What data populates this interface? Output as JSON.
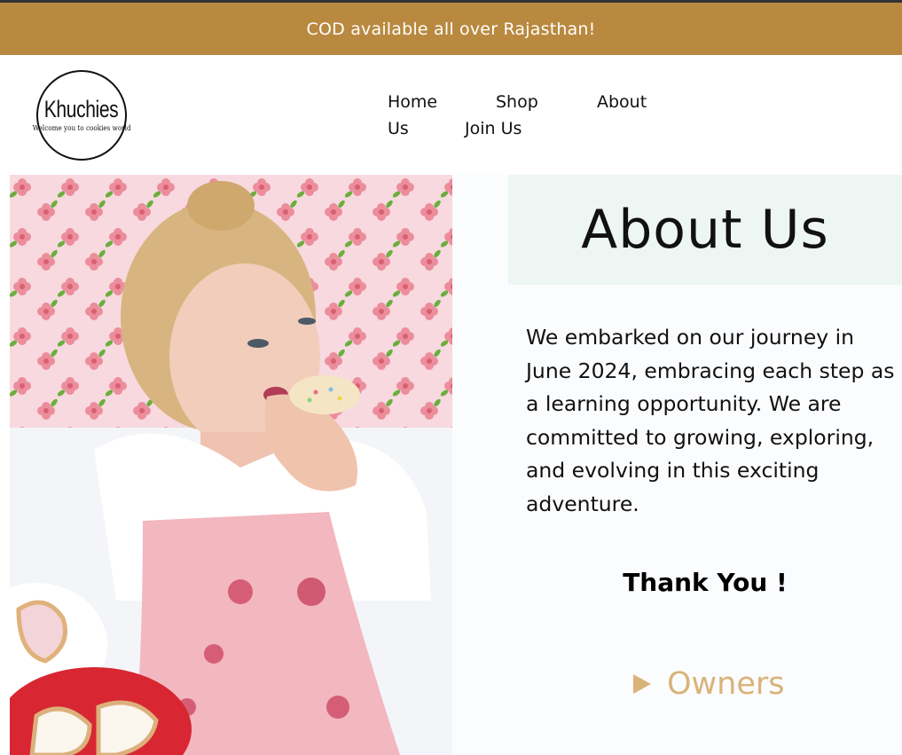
{
  "announcement": "COD available all over Rajasthan!",
  "logo": {
    "name": "Khuchies",
    "tagline": "Welcome you to cookies world"
  },
  "nav": {
    "home": "Home",
    "shop": "Shop",
    "about_part1": "About",
    "about_part2": "Us",
    "join": "Join Us"
  },
  "hero": {
    "photo_icon": "woman-eating-cookie-image"
  },
  "about": {
    "title": "About Us",
    "text": "We embarked on our journey in June 2024, embracing each step as a learning opportunity. We are committed to growing, exploring, and evolving in this exciting adventure.",
    "thanks": "Thank You !",
    "owners_label": "Owners",
    "owners_icon": "disclosure-triangle-icon"
  },
  "colors": {
    "banner": "#b8893f",
    "accent": "#d9b37a",
    "about_box": "#eef6f4"
  }
}
